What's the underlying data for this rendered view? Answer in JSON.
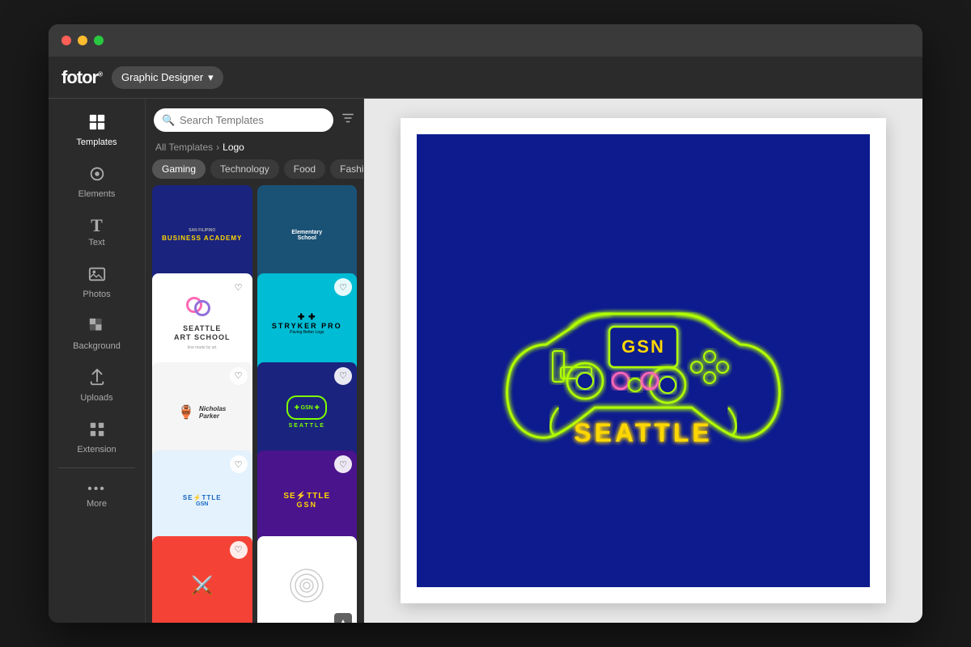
{
  "window": {
    "title": "Fotor Graphic Designer"
  },
  "topbar": {
    "logo": "fotor",
    "mode_label": "Graphic Designer",
    "mode_dropdown_arrow": "▾"
  },
  "sidebar": {
    "items": [
      {
        "id": "templates",
        "label": "Templates",
        "icon": "⊞",
        "active": true
      },
      {
        "id": "elements",
        "label": "Elements",
        "icon": "◎",
        "active": false
      },
      {
        "id": "text",
        "label": "Text",
        "icon": "T",
        "active": false
      },
      {
        "id": "photos",
        "label": "Photos",
        "icon": "🖼",
        "active": false
      },
      {
        "id": "background",
        "label": "Background",
        "icon": "▦",
        "active": false
      },
      {
        "id": "uploads",
        "label": "Uploads",
        "icon": "⬆",
        "active": false
      },
      {
        "id": "extension",
        "label": "Extension",
        "icon": "⊞",
        "active": false
      },
      {
        "id": "more",
        "label": "More",
        "icon": "•••",
        "active": false
      }
    ]
  },
  "templates_panel": {
    "search_placeholder": "Search Templates",
    "breadcrumb_all": "All Templates",
    "breadcrumb_separator": "›",
    "breadcrumb_current": "Logo",
    "categories": [
      {
        "id": "gaming",
        "label": "Gaming",
        "active": true
      },
      {
        "id": "technology",
        "label": "Technology",
        "active": false
      },
      {
        "id": "food",
        "label": "Food",
        "active": false
      },
      {
        "id": "fashion",
        "label": "Fashion",
        "active": false
      }
    ],
    "cards": [
      {
        "id": 1,
        "type": "dark-blue-academy"
      },
      {
        "id": 2,
        "type": "elementary-school"
      },
      {
        "id": 3,
        "type": "seattle-art-school"
      },
      {
        "id": 4,
        "type": "stryker-pro"
      },
      {
        "id": 5,
        "type": "nicholas-parker"
      },
      {
        "id": 6,
        "type": "gsn-seattle-dark"
      },
      {
        "id": 7,
        "type": "seattle-blue"
      },
      {
        "id": 8,
        "type": "seattle-gsn-lightning"
      },
      {
        "id": 9,
        "type": "red-cross"
      },
      {
        "id": 10,
        "type": "spiral-white"
      }
    ]
  },
  "canvas": {
    "design_title": "GSN SEATTLE",
    "gsn_label": "GSN",
    "seattle_label": "SEATTLE"
  },
  "filter_icon": "≡",
  "search_icon": "🔍"
}
